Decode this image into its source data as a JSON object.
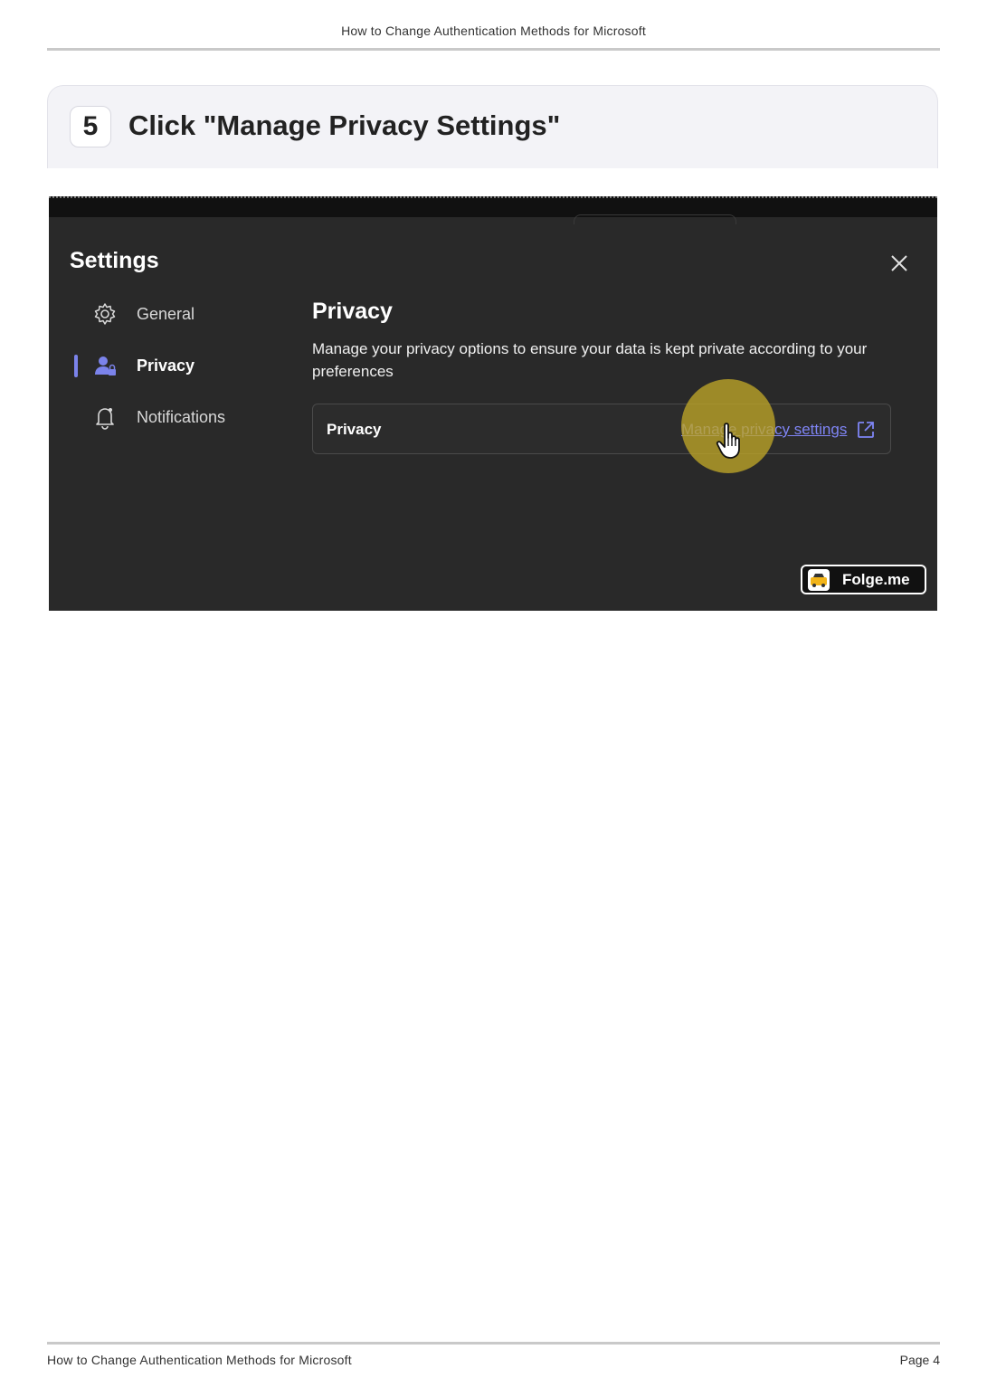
{
  "document": {
    "header": "How to Change Authentication Methods for Microsoft",
    "footer_left": "How to Change Authentication Methods for Microsoft",
    "footer_right": "Page 4"
  },
  "step": {
    "number": "5",
    "title": "Click \"Manage Privacy Settings\""
  },
  "screenshot": {
    "settings_title": "Settings",
    "nav": [
      {
        "label": "General",
        "icon": "gear-icon"
      },
      {
        "label": "Privacy",
        "icon": "person-lock-icon",
        "active": true
      },
      {
        "label": "Notifications",
        "icon": "bell-icon"
      }
    ],
    "pane_title": "Privacy",
    "pane_description": "Manage your privacy options to ensure your data is kept private according to your preferences",
    "privacy_card": {
      "label": "Privacy",
      "link": "Manage privacy settings"
    },
    "brand": "Folge.me",
    "colors": {
      "accent": "#7b83eb",
      "link": "#7f85f5",
      "highlight": "#bea528"
    }
  }
}
